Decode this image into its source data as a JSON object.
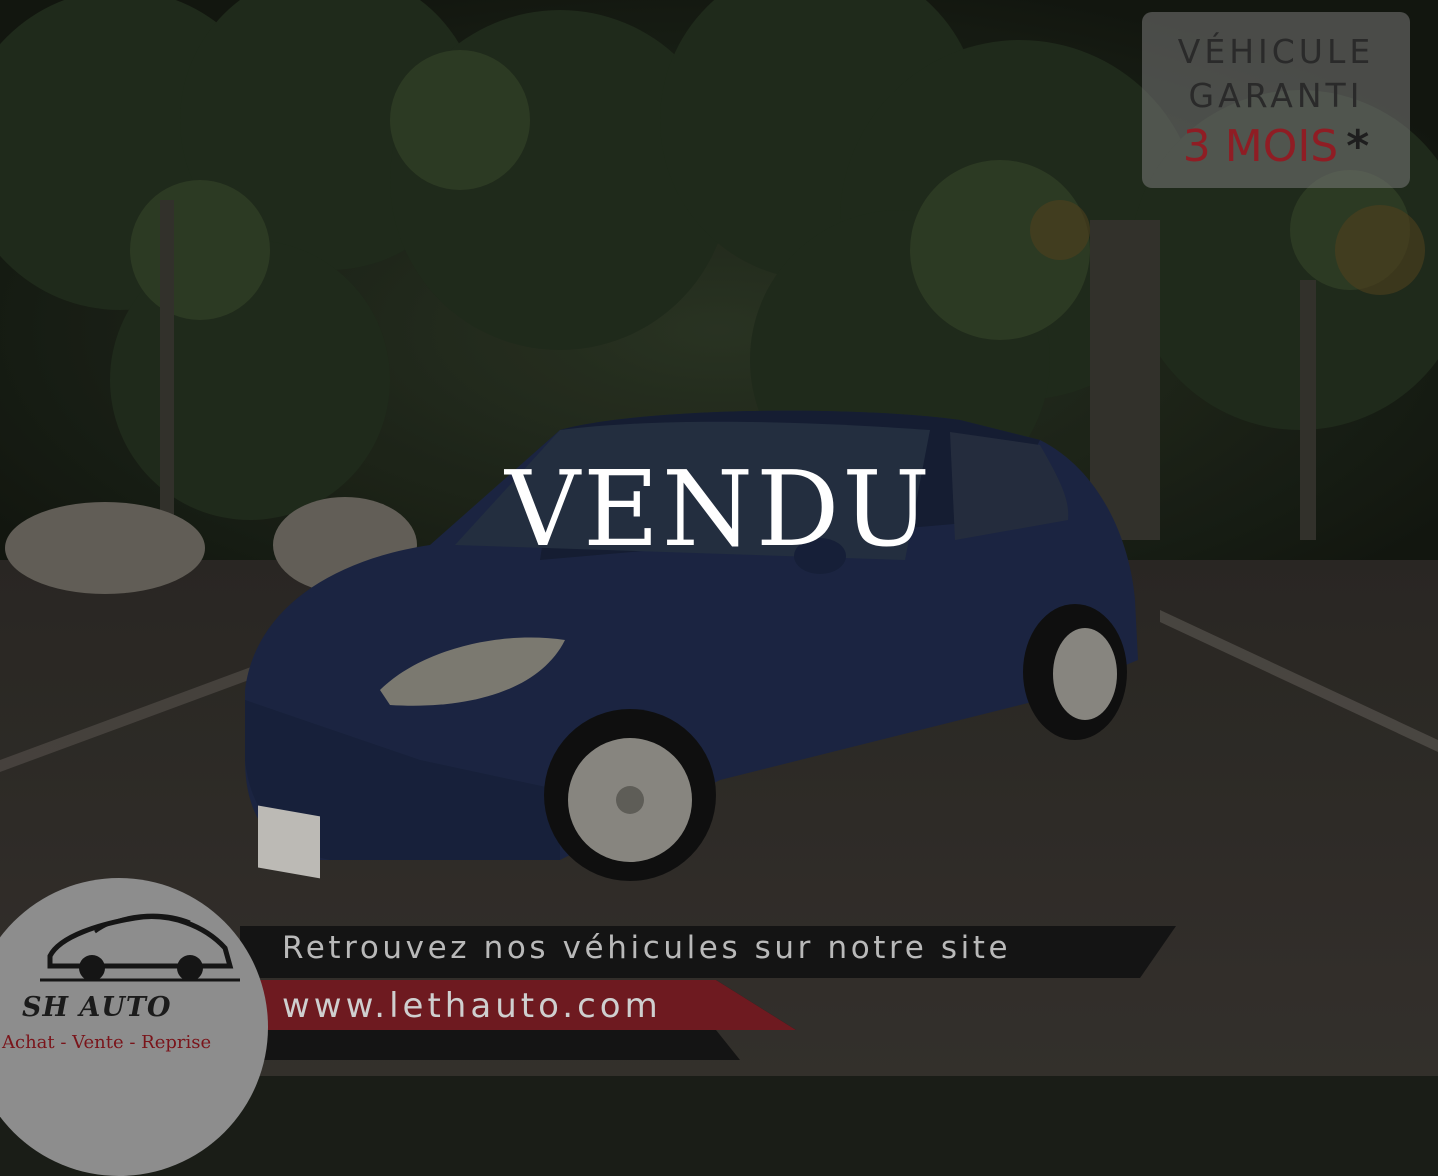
{
  "overlay": {
    "sold_label": "VENDU"
  },
  "warranty_badge": {
    "line1": "VÉHICULE",
    "line2": "GARANTI",
    "line3": "3 MOIS",
    "asterisk": "*"
  },
  "banner": {
    "tagline": "Retrouvez nos véhicules sur notre site",
    "website": "www.lethauto.com"
  },
  "logo": {
    "name": "SH AUTO",
    "tagline": "Achat - Vente - Reprise"
  },
  "colors": {
    "accent_red": "#8f1d24",
    "banner_dark": "#151515",
    "car_blue": "#1f2a4a"
  }
}
